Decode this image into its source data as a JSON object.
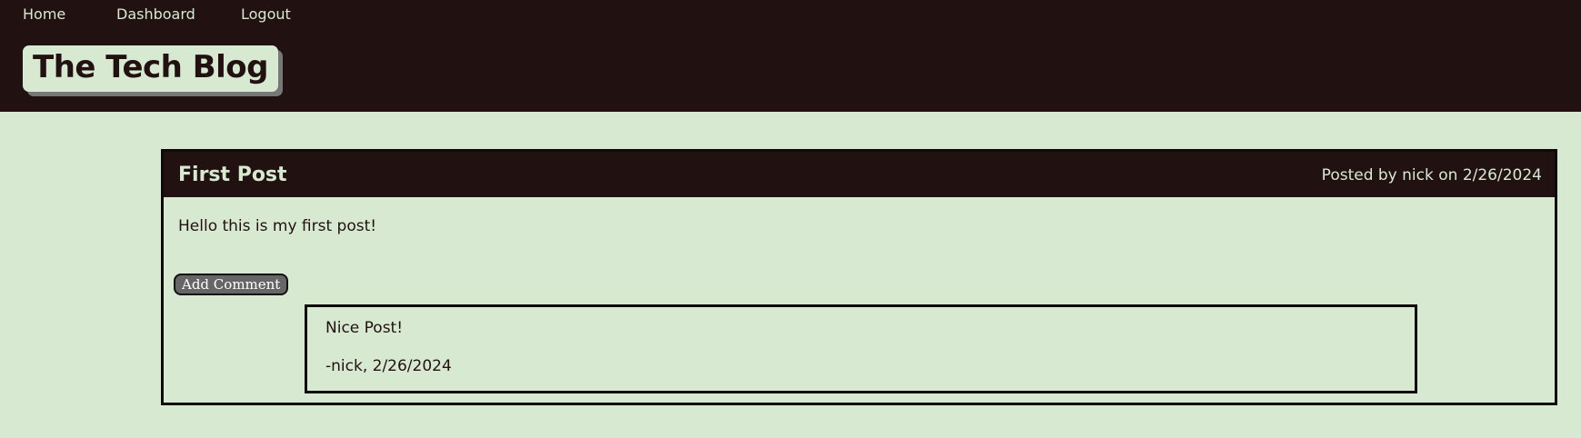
{
  "nav": {
    "home": "Home",
    "dashboard": "Dashboard",
    "logout": "Logout"
  },
  "site": {
    "title": "The Tech Blog"
  },
  "post": {
    "title": "First Post",
    "meta": "Posted by nick on 2/26/2024",
    "body": "Hello this is my first post!",
    "add_comment_label": "Add Comment",
    "comments": [
      {
        "text": "Nice Post!",
        "meta": "-nick, 2/26/2024"
      }
    ]
  },
  "colors": {
    "header_bg": "#221111",
    "page_bg": "#d8e9d2",
    "button_bg": "#666666"
  }
}
